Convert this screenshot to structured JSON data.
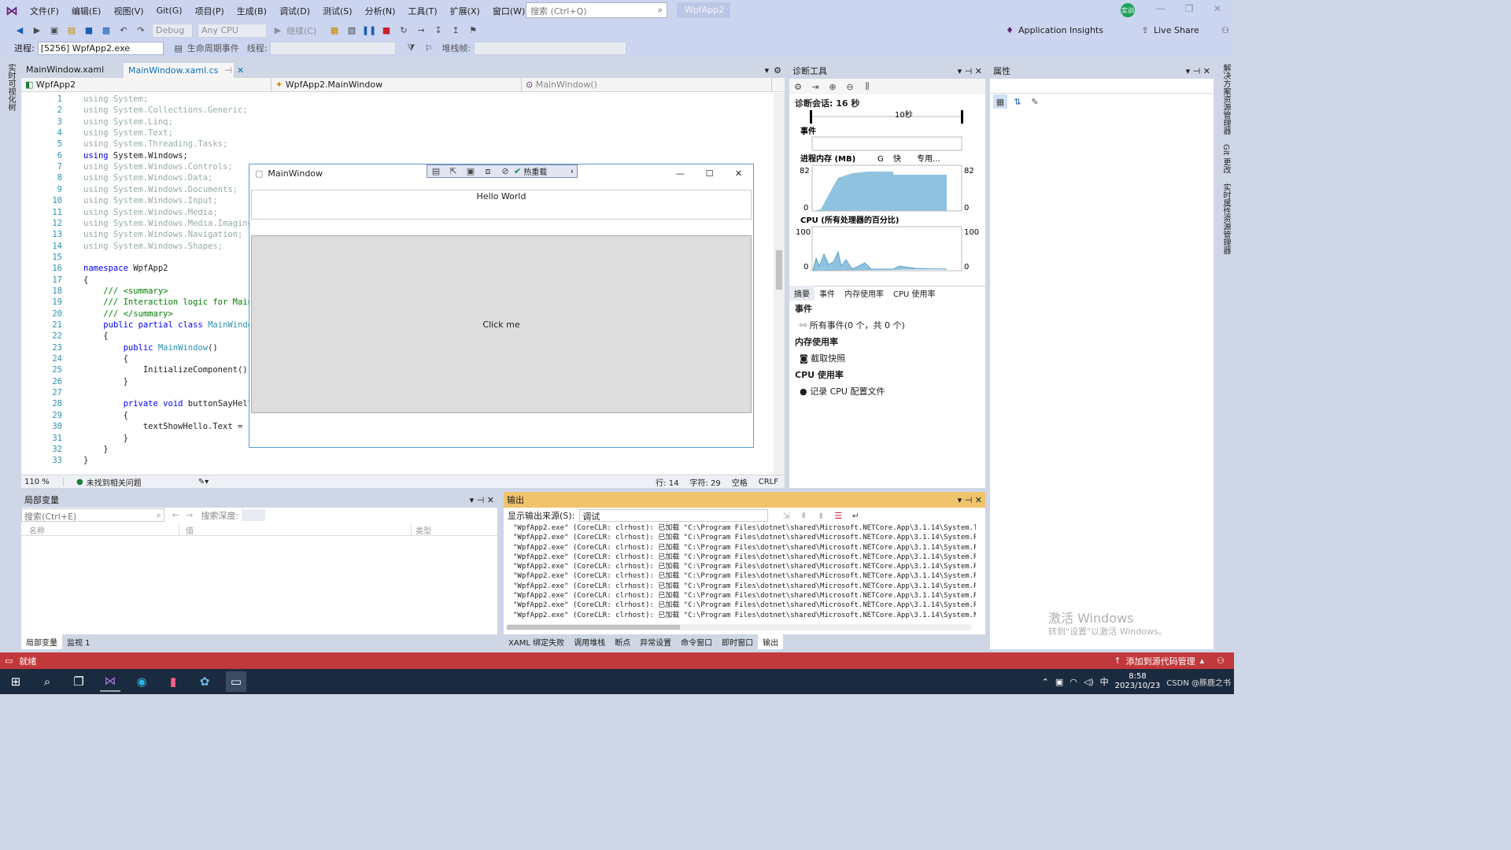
{
  "menubar": {
    "items": [
      "文件(F)",
      "编辑(E)",
      "视图(V)",
      "Git(G)",
      "项目(P)",
      "生成(B)",
      "调试(D)",
      "测试(S)",
      "分析(N)",
      "工具(T)",
      "扩展(X)",
      "窗口(W)",
      "帮助(H)"
    ],
    "search_placeholder": "搜索 (Ctrl+Q)",
    "solution_name": "WpfApp2",
    "avatar": "实训"
  },
  "toolbar": {
    "config": "Debug",
    "platform": "Any CPU",
    "continue_label": "继续(C)",
    "app_insights": "Application Insights",
    "live_share": "Live Share"
  },
  "toolbar2": {
    "process_label": "进程:",
    "process_value": "[5256] WpfApp2.exe",
    "lifecycle_label": "生命周期事件",
    "thread_label": "线程:",
    "stackframe_label": "堆栈帧:"
  },
  "left_strip": {
    "label": "实时可视化树"
  },
  "right_strip": {
    "labels": [
      "解决方案资源管理器",
      "Git 更改",
      "实时属性资源管理器"
    ]
  },
  "editor": {
    "tabs": [
      "MainWindow.xaml",
      "MainWindow.xaml.cs"
    ],
    "nav": [
      "WpfApp2",
      "WpfApp2.MainWindow",
      "MainWindow()"
    ],
    "zoom": "110 %",
    "issues": "未找到相关问题",
    "line": "行: 14",
    "col": "字符: 29",
    "space": "空格",
    "eol": "CRLF"
  },
  "code_lines": [
    "using System;",
    "using System.Collections.Generic;",
    "using System.Linq;",
    "using System.Text;",
    "using System.Threading.Tasks;",
    "using System.Windows;",
    "using System.Windows.Controls;",
    "using System.Windows.Data;",
    "using System.Windows.Documents;",
    "using System.Windows.Input;",
    "using System.Windows.Media;",
    "using System.Windows.Media.Imaging;",
    "using System.Windows.Navigation;",
    "using System.Windows.Shapes;",
    "",
    "namespace WpfApp2",
    "{",
    "    /// <summary>",
    "    /// Interaction logic for MainWi",
    "    /// </summary>",
    "    public partial class MainWindow",
    "    {",
    "        public MainWindow()",
    "        {",
    "            InitializeComponent();",
    "        }",
    "",
    "        private void buttonSayHello_",
    "        {",
    "            textShowHello.Text = \"He",
    "        }",
    "    }",
    "}"
  ],
  "mainwindow": {
    "title": "MainWindow",
    "hot_reload": "热重载",
    "hello": "Hello World",
    "button": "Click me"
  },
  "diag": {
    "title": "诊断工具",
    "session": "诊断会话: 16 秒",
    "tick": "10秒",
    "events_header": "事件",
    "memory_header": "进程内存 (MB)",
    "mem_legend": [
      "G",
      "快",
      "专用..."
    ],
    "mem_max": "82",
    "mem_min": "0",
    "cpu_header": "CPU (所有处理器的百分比)",
    "cpu_max": "100",
    "cpu_min": "0",
    "tabs": [
      "摘要",
      "事件",
      "内存使用率",
      "CPU 使用率"
    ],
    "sec_events": "事件",
    "all_events": "所有事件(0 个，共 0 个)",
    "sec_mem": "内存使用率",
    "snapshot": "截取快照",
    "sec_cpu": "CPU 使用率",
    "cpu_profile": "记录 CPU 配置文件"
  },
  "props": {
    "title": "属性",
    "watermark1": "激活 Windows",
    "watermark2": "转到\"设置\"以激活 Windows。"
  },
  "locals": {
    "title": "局部变量",
    "search_placeholder": "搜索(Ctrl+E)",
    "depth_label": "搜索深度:",
    "cols": [
      "名称",
      "值",
      "类型"
    ],
    "bottom_tabs": [
      "局部变量",
      "监视 1"
    ]
  },
  "output": {
    "title": "输出",
    "source_label": "显示输出来源(S):",
    "source_value": "调试",
    "lines": [
      "\"WpfApp2.exe\" (CoreCLR: clrhost): 已加载 \"C:\\Program Files\\dotnet\\shared\\Microsoft.NETCore.App\\3.1.14\\System.Threading.",
      "\"WpfApp2.exe\" (CoreCLR: clrhost): 已加载 \"C:\\Program Files\\dotnet\\shared\\Microsoft.NETCore.App\\3.1.14\\System.Runtime.Se",
      "\"WpfApp2.exe\" (CoreCLR: clrhost): 已加载 \"C:\\Program Files\\dotnet\\shared\\Microsoft.NETCore.App\\3.1.14\\System.Private.De",
      "\"WpfApp2.exe\" (CoreCLR: clrhost): 已加载 \"C:\\Program Files\\dotnet\\shared\\Microsoft.NETCore.App\\3.1.14\\System.Runtime.Se",
      "\"WpfApp2.exe\" (CoreCLR: clrhost): 已加载 \"C:\\Program Files\\dotnet\\shared\\Microsoft.NETCore.App\\3.1.14\\System.Runtime.Se",
      "\"WpfApp2.exe\" (CoreCLR: clrhost): 已加载 \"C:\\Program Files\\dotnet\\shared\\Microsoft.NETCore.App\\3.1.14\\System.Reflection",
      "\"WpfApp2.exe\" (CoreCLR: clrhost): 已加载 \"C:\\Program Files\\dotnet\\shared\\Microsoft.NETCore.App\\3.1.14\\System.Reflection",
      "\"WpfApp2.exe\" (CoreCLR: clrhost): 已加载 \"C:\\Program Files\\dotnet\\shared\\Microsoft.NETCore.App\\3.1.14\\System.Reflection",
      "\"WpfApp2.exe\" (CoreCLR: clrhost): 已加载 \"C:\\Program Files\\dotnet\\shared\\Microsoft.NETCore.App\\3.1.14\\System.Runtime.Se",
      "\"WpfApp2.exe\" (CoreCLR: clrhost): 已加载 \"C:\\Program Files\\dotnet\\shared\\Microsoft.NETCore.App\\3.1.14\\System.Net.Reques"
    ],
    "bottom_tabs": [
      "XAML 绑定失败",
      "调用堆栈",
      "断点",
      "异常设置",
      "命令窗口",
      "即时窗口",
      "输出"
    ]
  },
  "statusbar": {
    "ready": "就绪",
    "source_control": "添加到源代码管理"
  },
  "taskbar": {
    "time": "8:58",
    "date": "2023/10/23",
    "ime": "中",
    "watermark": "CSDN @豚鹿之书"
  },
  "colors": {
    "statusbar": "#c2393b",
    "accent": "#68217a",
    "output_title": "#f0c36d"
  }
}
